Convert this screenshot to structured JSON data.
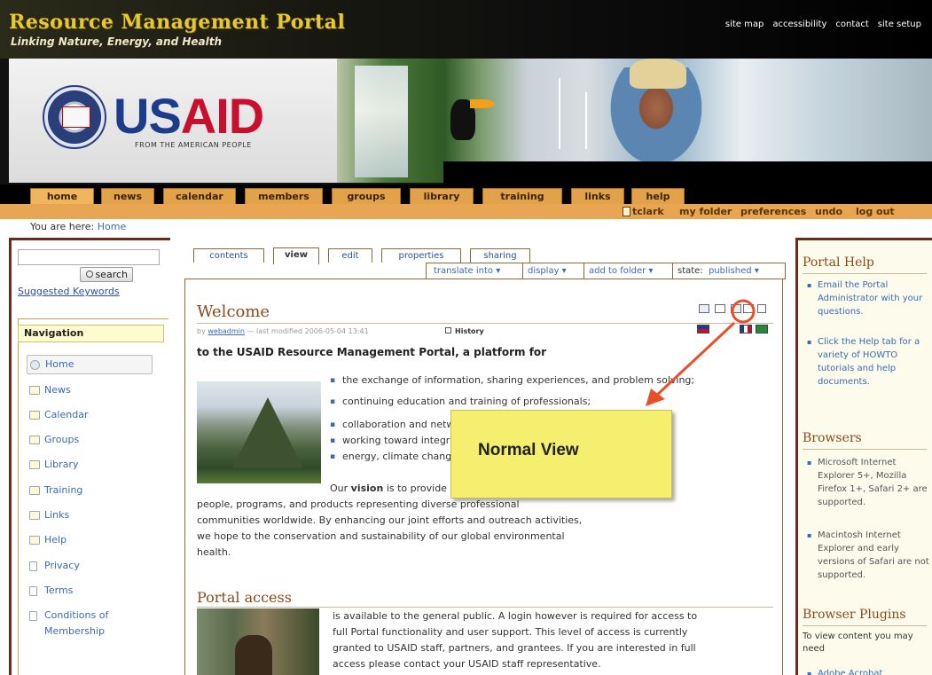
{
  "banner": {
    "title": "Resource Management Portal",
    "tagline": "Linking Nature, Energy, and Health",
    "site_actions": [
      "site map",
      "accessibility",
      "contact",
      "site setup"
    ],
    "usaid_us": "US",
    "usaid_aid": "AID",
    "usaid_sub": "FROM THE AMERICAN PEOPLE"
  },
  "global_nav": {
    "tabs": [
      "home",
      "news",
      "calendar",
      "members",
      "groups",
      "library",
      "training",
      "links",
      "help"
    ],
    "selected": "home"
  },
  "personal_bar": {
    "user": "tclark",
    "items": [
      "my folder",
      "preferences",
      "undo",
      "log out"
    ]
  },
  "breadcrumbs": {
    "prefix": "You are here:",
    "current": "Home"
  },
  "search": {
    "button_label": "search",
    "suggested": "Suggested Keywords"
  },
  "navigation": {
    "header": "Navigation",
    "items": [
      "Home",
      "News",
      "Calendar",
      "Groups",
      "Library",
      "Training",
      "Links",
      "Help",
      "Privacy",
      "Terms",
      "Conditions of",
      "Membership"
    ]
  },
  "content_tabs": [
    "contents",
    "view",
    "edit",
    "properties",
    "sharing"
  ],
  "content_actions": {
    "translate": "translate into ▾",
    "display": "display ▾",
    "add_to_folder": "add to folder ▾",
    "state_prefix": "state:",
    "state_value": "published ▾"
  },
  "document": {
    "title": "Welcome",
    "byline_prefix": "by",
    "byline_author": "webadmin",
    "byline_rest": "— last modified 2006-05-04 13:41",
    "history": "History",
    "lead": "to the USAID Resource Management Portal, a platform for",
    "bullets": [
      "the exchange of information, sharing experiences, and problem solving;",
      "continuing education and training of professionals;",
      "collaboration and networking among partners and partners",
      "working toward integrated approaches with renewable",
      "energy, climate change..."
    ],
    "vision_lead": "Our",
    "vision_word": "vision",
    "vision_rest_1": "is to provide a platform for direct links to",
    "vision_rest_2": "people, programs, and products representing diverse professional",
    "vision_rest_3": "communities worldwide. By enhancing our joint efforts and outreach activities,",
    "vision_rest_4": "we hope to the conservation and sustainability of our global environmental",
    "vision_rest_5": "health.",
    "callout": "Normal View",
    "section_title": "Portal access",
    "access_1": "is available to the general public. A login however is required for access to",
    "access_2": "full Portal functionality and user support. This level of access is currently",
    "access_3": "granted to USAID staff, partners, and grantees. If you are interested in full",
    "access_4": "access please contact your USAID staff representative."
  },
  "right": {
    "help_title": "Portal Help",
    "help_items": [
      "Email the Portal Administrator with your questions.",
      "Click the Help tab for a variety of HOWTO tutorials and help documents."
    ],
    "browsers_title": "Browsers",
    "browser_items": [
      "Microsoft Internet Explorer 5+, Mozilla Firefox 1+, Safari 2+ are supported.",
      "Macintosh Internet Explorer and early versions of Safari are not supported."
    ],
    "plugins_title": "Browser Plugins",
    "plugins_desc": "To view content you may need",
    "plugins_first": "Adobe Acrobat"
  },
  "colors": {
    "tab_orange": "#e2a24a",
    "link_blue": "#3b6ab5",
    "heading_brown": "#8a4a1a",
    "callout_yellow": "#f4ef6e",
    "arrow_red": "#e6502a"
  }
}
